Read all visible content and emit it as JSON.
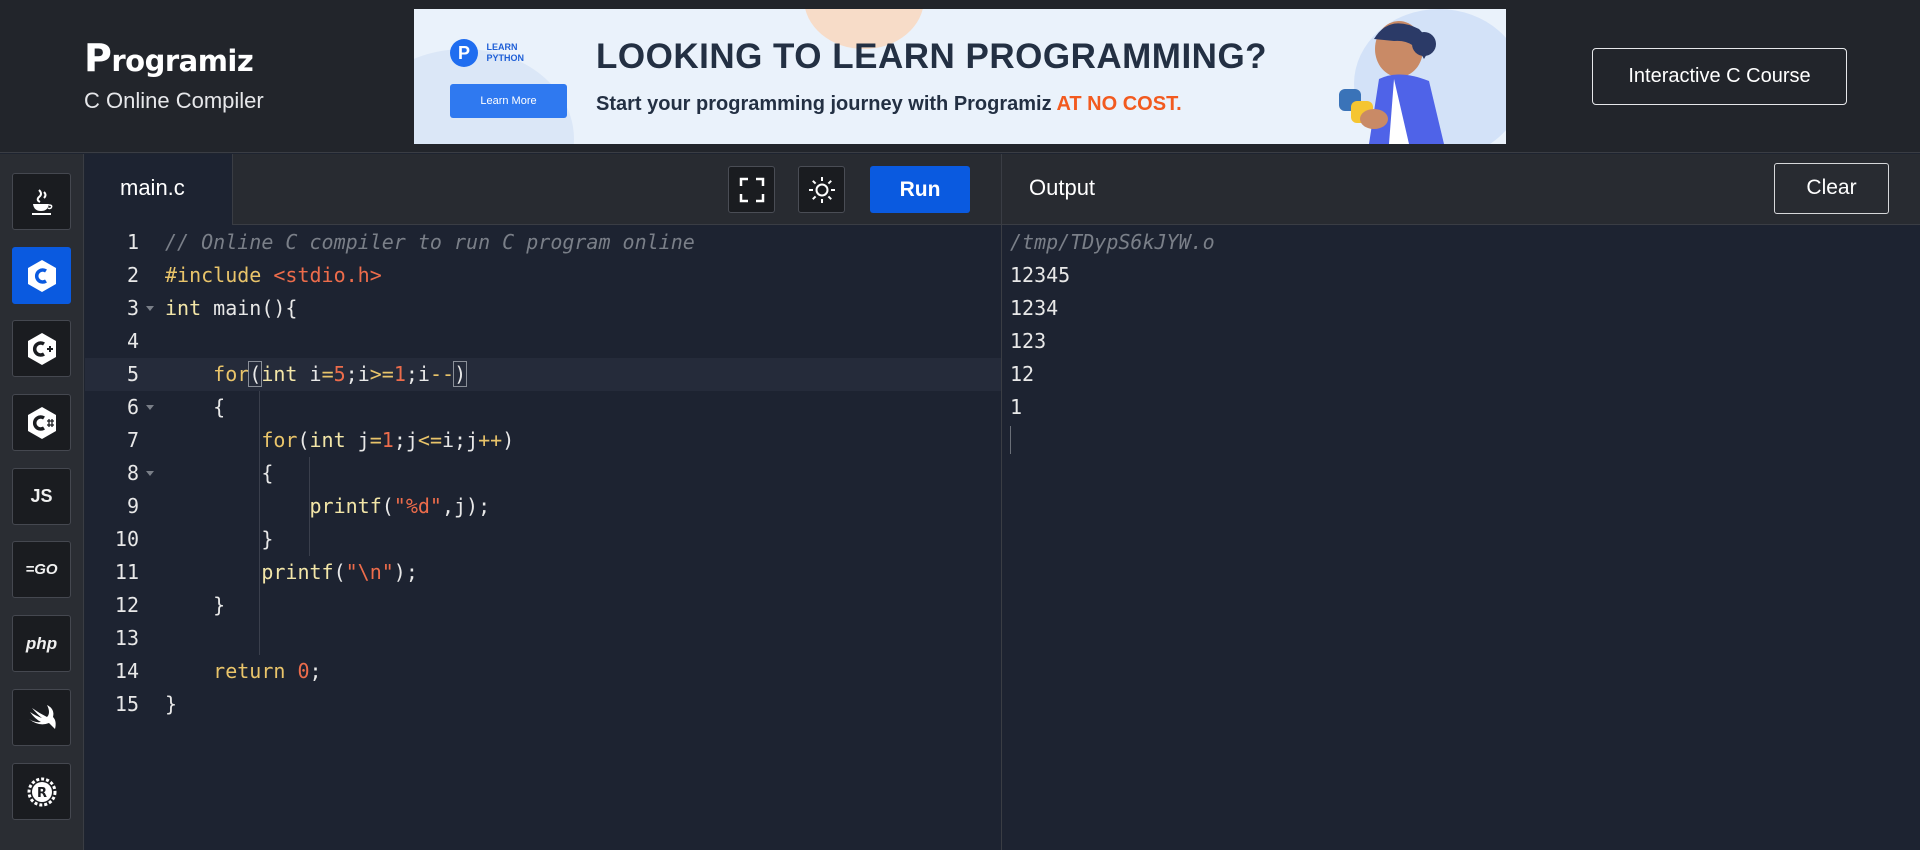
{
  "header": {
    "logo_text": "rogramiz",
    "logo_initial": "P",
    "subtitle": "C Online Compiler",
    "course_button": "Interactive C Course"
  },
  "banner": {
    "badge_line1": "LEARN",
    "badge_line2": "PYTHON",
    "button": "Learn More",
    "headline": "LOOKING TO LEARN PROGRAMMING?",
    "sub_text": "Start your programming journey with Programiz ",
    "sub_highlight": "AT NO COST.",
    "colors": {
      "bg": "#eaf2fb",
      "accent": "#f25a1f",
      "button": "#2f79f0"
    }
  },
  "sidebar": {
    "languages": [
      {
        "name": "java-icon",
        "label": "☕",
        "active": false
      },
      {
        "name": "c-icon",
        "label": "C",
        "active": true
      },
      {
        "name": "cpp-icon",
        "label": "C+",
        "active": false
      },
      {
        "name": "csharp-icon",
        "label": "C#",
        "active": false
      },
      {
        "name": "javascript-icon",
        "label": "JS",
        "active": false
      },
      {
        "name": "go-icon",
        "label": "GO",
        "active": false
      },
      {
        "name": "php-icon",
        "label": "php",
        "active": false
      },
      {
        "name": "swift-icon",
        "label": "swift",
        "active": false
      },
      {
        "name": "rust-icon",
        "label": "R",
        "active": false
      }
    ]
  },
  "editor": {
    "tab": "main.c",
    "run_label": "Run",
    "line_numbers": [
      "1",
      "2",
      "3",
      "4",
      "5",
      "6",
      "7",
      "8",
      "9",
      "10",
      "11",
      "12",
      "13",
      "14",
      "15"
    ]
  },
  "output": {
    "title": "Output",
    "clear_label": "Clear",
    "lines": [
      "/tmp/TDypS6kJYW.o",
      "12345",
      "1234",
      "123",
      "12",
      "1"
    ]
  },
  "colors": {
    "accent": "#0a5ae0",
    "editor_bg": "#1d2331",
    "bar_bg": "#282b31"
  }
}
